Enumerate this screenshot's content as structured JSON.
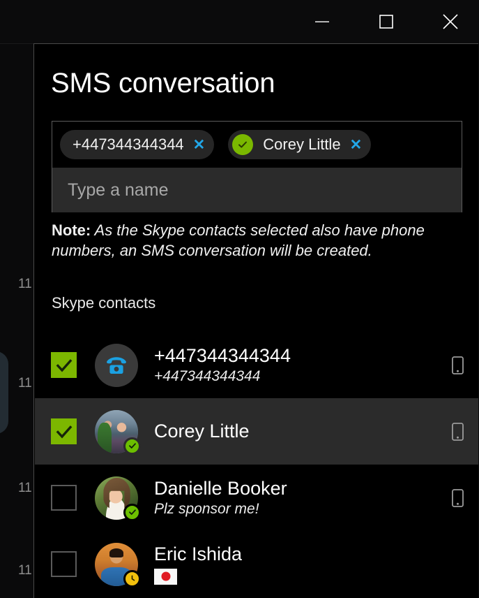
{
  "window": {
    "controls": [
      {
        "name": "minimize",
        "glyph": "minimize-icon"
      },
      {
        "name": "maximize",
        "glyph": "maximize-icon"
      },
      {
        "name": "close",
        "glyph": "close-icon"
      }
    ]
  },
  "background": {
    "timestamps": [
      "11",
      "11",
      "11",
      "11"
    ]
  },
  "dialog": {
    "title": "SMS conversation",
    "recipients": [
      {
        "label": "+447344344344",
        "has_avatar": false,
        "remove_glyph": "✕"
      },
      {
        "label": "Corey Little",
        "has_avatar": true,
        "avatar_color": "#7ab800",
        "remove_glyph": "✕"
      }
    ],
    "name_input": {
      "value": "",
      "placeholder": "Type a name"
    },
    "note": {
      "label": "Note:",
      "text": " As the Skype contacts selected also have phone numbers, an SMS conversation will be created."
    },
    "section_header": "Skype contacts",
    "contacts": [
      {
        "name": "+447344344344",
        "subtitle": "+447344344344",
        "subtitle_style": "mood",
        "checked": true,
        "selected": false,
        "avatar_type": "phone-icon",
        "avatar_class": "",
        "badge": "none",
        "flag": "",
        "mobile_icon": true
      },
      {
        "name": "Corey Little",
        "subtitle": "",
        "subtitle_style": "mood",
        "checked": true,
        "selected": true,
        "avatar_type": "photo",
        "avatar_class": "ph-corey",
        "badge": "online",
        "flag": "",
        "mobile_icon": true
      },
      {
        "name": "Danielle Booker",
        "subtitle": "Plz sponsor me!",
        "subtitle_style": "mood",
        "checked": false,
        "selected": false,
        "avatar_type": "photo",
        "avatar_class": "ph-danielle",
        "badge": "online",
        "flag": "",
        "mobile_icon": true
      },
      {
        "name": "Eric Ishida",
        "subtitle": "",
        "subtitle_style": "flag",
        "checked": false,
        "selected": false,
        "avatar_type": "photo",
        "avatar_class": "ph-eric",
        "badge": "away",
        "flag": "japan-flag",
        "mobile_icon": false
      }
    ]
  },
  "colors": {
    "accent_green": "#7cb700",
    "link_blue": "#22a7e8",
    "away_yellow": "#f2c00d",
    "dialog_bg": "#000000",
    "row_selected_bg": "#2b2b2b",
    "input_bg": "#2b2b2b"
  }
}
